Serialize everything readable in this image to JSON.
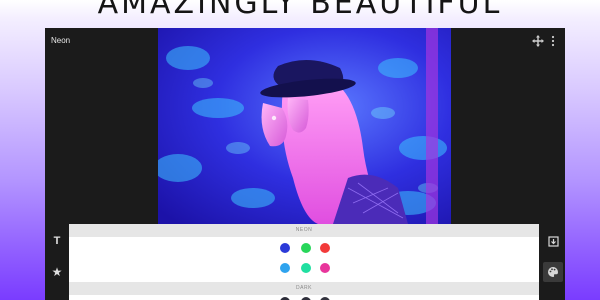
{
  "headline": "AMAZINGLY BEAUTIFUL",
  "app": {
    "title": "Neon"
  },
  "toolbar": {
    "icons": [
      "move-icon",
      "more-vert-icon"
    ]
  },
  "left_tools": [
    {
      "label": "T",
      "icon": "text-icon"
    },
    {
      "label": "★",
      "icon": "star-icon"
    }
  ],
  "right_tools": [
    {
      "icon": "save-image-icon"
    },
    {
      "icon": "palette-icon"
    }
  ],
  "panel": {
    "sections": [
      {
        "title": "NEON",
        "colors": [
          "#2b3ad8",
          "#27d65a",
          "#f23a3a",
          "#2fa3ee",
          "#20dfa0",
          "#e8359b"
        ]
      },
      {
        "title": "DARK",
        "colors": [
          "#2c2c38",
          "#30303c",
          "#34343f"
        ]
      }
    ]
  }
}
